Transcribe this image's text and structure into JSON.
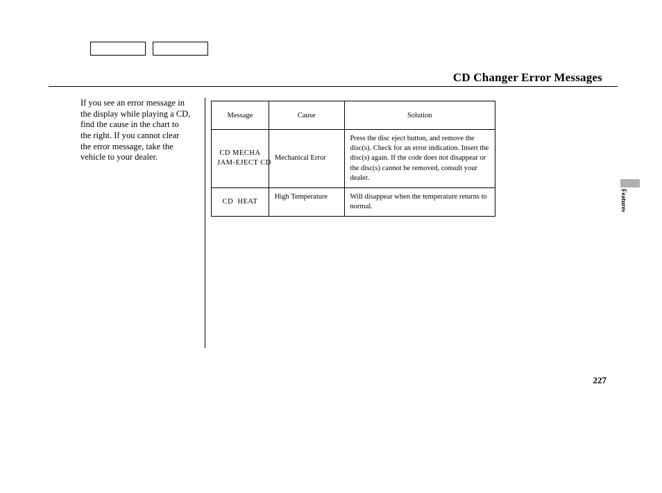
{
  "header": {
    "title": "CD Changer Error Messages"
  },
  "intro": "If you see an error message in the display while playing a CD, find the cause in the chart to the right. If you cannot clear the error message, take the vehicle to your dealer.",
  "table": {
    "headers": {
      "message": "Message",
      "cause": "Cause",
      "solution": "Solution"
    },
    "rows": [
      {
        "message": "CD MECHA\nJAM-EJECT CD",
        "cause": "Mechanical Error",
        "solution": "Press the disc eject button, and remove the disc(s). Check for an error indication. Insert the disc(s) again. If the code does not disappear or the disc(s) cannot be removed, consult your dealer."
      },
      {
        "message": "CD  HEAT",
        "cause": "High Temperature",
        "solution": "Will disappear when the temperature returns to normal."
      }
    ]
  },
  "sideTab": "Features",
  "pageNumber": "227"
}
